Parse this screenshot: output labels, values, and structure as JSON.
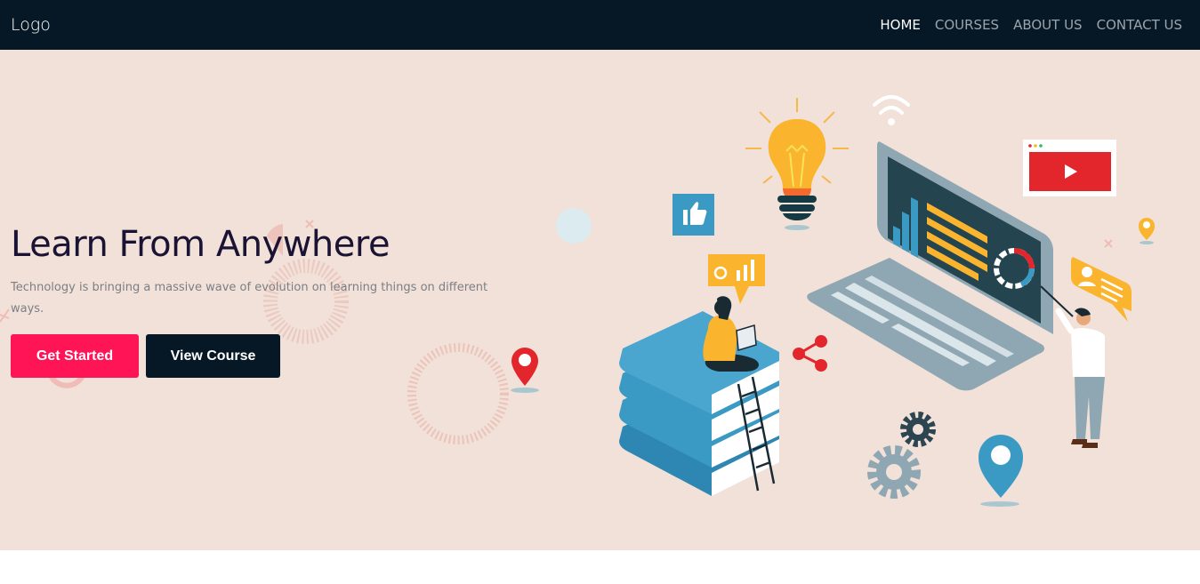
{
  "nav": {
    "logo": "Logo",
    "links": [
      {
        "label": "HOME",
        "active": true
      },
      {
        "label": "COURSES",
        "active": false
      },
      {
        "label": "ABOUT US",
        "active": false
      },
      {
        "label": "CONTACT US",
        "active": false
      }
    ]
  },
  "hero": {
    "title": "Learn From Anywhere",
    "subtitle": "Technology is bringing a massive wave of evolution on learning things on different ways.",
    "primary_button": "Get Started",
    "secondary_button": "View Course"
  },
  "colors": {
    "navbar_bg": "#061825",
    "hero_bg": "#f1e1d8",
    "accent": "#ff1456",
    "title": "#1a1333"
  }
}
